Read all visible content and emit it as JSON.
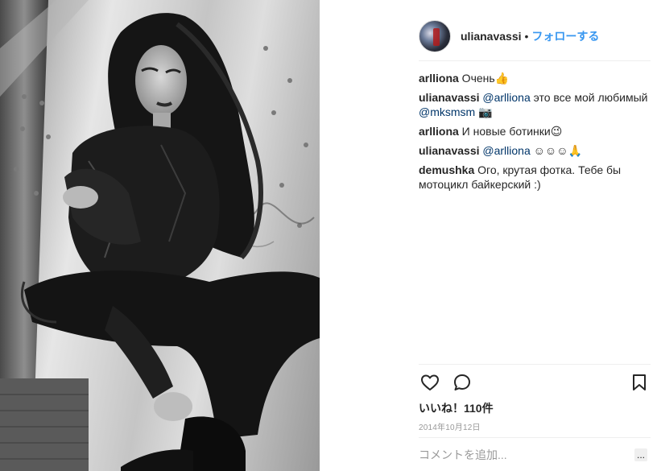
{
  "post": {
    "username": "ulianavassi",
    "separator": "•",
    "follow_label": "フォローする"
  },
  "comments": [
    {
      "user": "arlliona",
      "segments": [
        {
          "type": "text",
          "value": " Очень"
        },
        {
          "type": "emoji",
          "value": "👍"
        }
      ]
    },
    {
      "user": "ulianavassi",
      "segments": [
        {
          "type": "text",
          "value": " "
        },
        {
          "type": "mention",
          "value": "@arlliona"
        },
        {
          "type": "text",
          "value": " это все мой любимый "
        },
        {
          "type": "mention",
          "value": "@mksmsm"
        },
        {
          "type": "text",
          "value": " "
        },
        {
          "type": "emoji",
          "value": "📷"
        }
      ]
    },
    {
      "user": "arlliona",
      "segments": [
        {
          "type": "text",
          "value": " И новые ботинки"
        },
        {
          "type": "emoji",
          "value": "😉"
        }
      ]
    },
    {
      "user": "ulianavassi",
      "segments": [
        {
          "type": "text",
          "value": " "
        },
        {
          "type": "mention",
          "value": "@arlliona"
        },
        {
          "type": "text",
          "value": " ☺☺☺"
        },
        {
          "type": "emoji",
          "value": "🙏"
        }
      ]
    },
    {
      "user": "demushka",
      "segments": [
        {
          "type": "text",
          "value": " Ого, крутая фотка. Тебе бы мотоцикл байкерский :)"
        }
      ]
    }
  ],
  "actions": {
    "like_icon": "heart-icon",
    "comment_icon": "comment-bubble-icon",
    "save_icon": "bookmark-icon"
  },
  "likes_label": "いいね！110件",
  "date_label": "2014年10月12日",
  "comment_box": {
    "placeholder": "コメントを追加...",
    "more_label": "..."
  }
}
